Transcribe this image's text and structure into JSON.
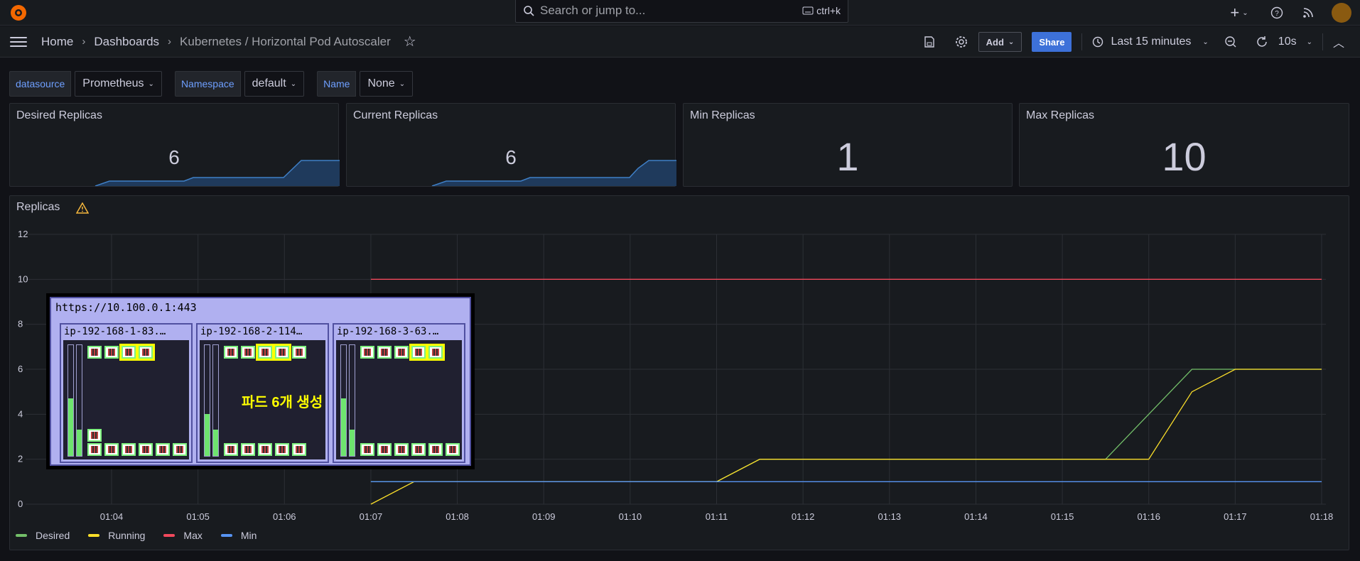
{
  "topbar": {
    "search_placeholder": "Search or jump to...",
    "search_shortcut": "ctrl+k"
  },
  "navbar": {
    "breadcrumbs": [
      "Home",
      "Dashboards",
      "Kubernetes / Horizontal Pod Autoscaler"
    ],
    "add_label": "Add",
    "share_label": "Share",
    "time_range": "Last 15 minutes",
    "refresh_interval": "10s"
  },
  "variables": [
    {
      "label": "datasource",
      "value": "Prometheus"
    },
    {
      "label": "Namespace",
      "value": "default"
    },
    {
      "label": "Name",
      "value": "None"
    }
  ],
  "stats": [
    {
      "title": "Desired Replicas",
      "value": "6"
    },
    {
      "title": "Current Replicas",
      "value": "6"
    },
    {
      "title": "Min Replicas",
      "value": "1"
    },
    {
      "title": "Max Replicas",
      "value": "10"
    }
  ],
  "replicas_panel": {
    "title": "Replicas"
  },
  "overlay": {
    "url": "https://10.100.0.1:443",
    "nodes": [
      "ip-192-168-1-83.…",
      "ip-192-168-2-114…",
      "ip-192-168-3-63.…"
    ],
    "annotation": "파드 6개 생성"
  },
  "chart_data": {
    "type": "line",
    "x": [
      "01:04",
      "01:05",
      "01:06",
      "01:07",
      "01:08",
      "01:09",
      "01:10",
      "01:11",
      "01:12",
      "01:13",
      "01:14",
      "01:15",
      "01:16",
      "01:17",
      "01:18"
    ],
    "yticks": [
      0,
      2,
      4,
      6,
      8,
      10,
      12
    ],
    "ylim": [
      0,
      12
    ],
    "grid": true,
    "legend_position": "bottom-left",
    "series": [
      {
        "name": "Desired",
        "color": "#73bf69",
        "points": [
          [
            7.0,
            1
          ],
          [
            7.5,
            1
          ],
          [
            11.0,
            1
          ],
          [
            11.5,
            2
          ],
          [
            15.5,
            2
          ],
          [
            16.5,
            6
          ],
          [
            18.0,
            6
          ]
        ]
      },
      {
        "name": "Running",
        "color": "#fade2a",
        "points": [
          [
            7.0,
            0
          ],
          [
            7.5,
            1
          ],
          [
            11.0,
            1
          ],
          [
            11.5,
            2
          ],
          [
            16.0,
            2
          ],
          [
            16.5,
            5
          ],
          [
            17.0,
            6
          ],
          [
            18.0,
            6
          ]
        ]
      },
      {
        "name": "Max",
        "color": "#f2495c",
        "points": [
          [
            7.0,
            10
          ],
          [
            18.0,
            10
          ]
        ]
      },
      {
        "name": "Min",
        "color": "#5794f2",
        "points": [
          [
            7.0,
            1
          ],
          [
            18.0,
            1
          ]
        ]
      }
    ]
  }
}
